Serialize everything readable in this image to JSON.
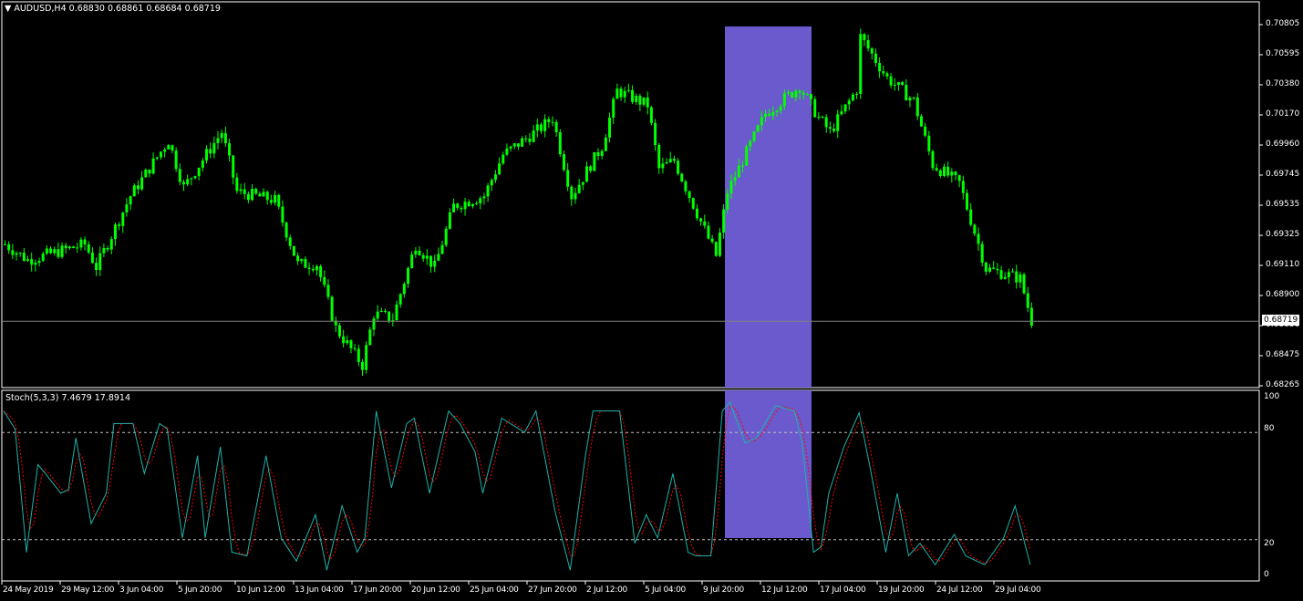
{
  "header": {
    "symbol": "AUDUSD,H4",
    "open": "0.68830",
    "high": "0.68861",
    "low": "0.68684",
    "close": "0.68719"
  },
  "indicator": {
    "name": "Stoch(5,3,3)",
    "main": "7.4679",
    "signal": "17.8914"
  },
  "current_price_label": "0.68719",
  "colors": {
    "bull": "#00ff00",
    "bear": "#00ff00",
    "highlight": "#6a5acd",
    "stoch_main": "#20b2aa",
    "stoch_signal": "#ff0000",
    "grid": "#c0c0c0"
  },
  "chart_data": [
    {
      "type": "candlestick",
      "title": "AUDUSD,H4",
      "ylim": [
        0.68265,
        0.70805
      ],
      "y_ticks": [
        "0.70805",
        "0.70595",
        "0.70380",
        "0.70170",
        "0.69960",
        "0.69745",
        "0.69535",
        "0.69325",
        "0.69110",
        "0.68900",
        "0.68686",
        "0.68475",
        "0.68265"
      ],
      "x_ticks": [
        "24 May 2019",
        "29 May 12:00",
        "3 Jun 04:00",
        "5 Jun 20:00",
        "10 Jun 12:00",
        "13 Jun 04:00",
        "17 Jun 20:00",
        "20 Jun 12:00",
        "25 Jun 04:00",
        "27 Jun 20:00",
        "2 Jul 12:00",
        "5 Jul 04:00",
        "9 Jul 20:00",
        "12 Jul 12:00",
        "17 Jul 04:00",
        "19 Jul 20:00",
        "24 Jul 12:00",
        "29 Jul 04:00"
      ],
      "bars": 270,
      "close_path_approx": [
        [
          0,
          0.6926
        ],
        [
          6,
          0.6915
        ],
        [
          21,
          0.6926
        ],
        [
          24,
          0.691
        ],
        [
          33,
          0.696
        ],
        [
          43,
          0.6999
        ],
        [
          47,
          0.6966
        ],
        [
          57,
          0.7005
        ],
        [
          61,
          0.6963
        ],
        [
          71,
          0.6957
        ],
        [
          77,
          0.6912
        ],
        [
          82,
          0.6912
        ],
        [
          87,
          0.6867
        ],
        [
          94,
          0.6841
        ],
        [
          97,
          0.6877
        ],
        [
          102,
          0.6874
        ],
        [
          108,
          0.6926
        ],
        [
          113,
          0.691
        ],
        [
          118,
          0.6953
        ],
        [
          126,
          0.696
        ],
        [
          131,
          0.6989
        ],
        [
          141,
          0.7008
        ],
        [
          144,
          0.7015
        ],
        [
          149,
          0.696
        ],
        [
          157,
          0.6995
        ],
        [
          161,
          0.7034
        ],
        [
          169,
          0.7024
        ],
        [
          172,
          0.6979
        ],
        [
          176,
          0.6985
        ],
        [
          180,
          0.696
        ],
        [
          187,
          0.6918
        ],
        [
          190,
          0.6963
        ],
        [
          200,
          0.7018
        ],
        [
          209,
          0.7037
        ],
        [
          214,
          0.7015
        ],
        [
          217,
          0.7005
        ],
        [
          224,
          0.7035
        ],
        [
          225,
          0.7072
        ],
        [
          232,
          0.7043
        ],
        [
          239,
          0.7027
        ],
        [
          244,
          0.6982
        ],
        [
          251,
          0.6969
        ],
        [
          258,
          0.6909
        ],
        [
          267,
          0.6902
        ],
        [
          270,
          0.6872
        ]
      ],
      "highlight_bars": [
        189,
        212
      ]
    },
    {
      "type": "line",
      "title": "Stoch(5,3,3)",
      "ylim": [
        0,
        100
      ],
      "y_ticks": [
        "100",
        "80",
        "20",
        "0"
      ],
      "levels": [
        80,
        20
      ],
      "main_path_approx": [
        [
          0,
          92
        ],
        [
          3,
          82
        ],
        [
          6,
          13
        ],
        [
          9,
          62
        ],
        [
          11,
          57
        ],
        [
          15,
          46
        ],
        [
          17,
          48
        ],
        [
          19,
          77
        ],
        [
          23,
          29
        ],
        [
          27,
          46
        ],
        [
          29,
          85
        ],
        [
          34,
          85
        ],
        [
          37,
          57
        ],
        [
          41,
          85
        ],
        [
          43,
          82
        ],
        [
          47,
          21
        ],
        [
          51,
          67
        ],
        [
          53,
          21
        ],
        [
          57,
          72
        ],
        [
          60,
          13
        ],
        [
          64,
          11
        ],
        [
          69,
          67
        ],
        [
          73,
          21
        ],
        [
          77,
          8
        ],
        [
          82,
          34
        ],
        [
          85,
          3
        ],
        [
          89,
          39
        ],
        [
          93,
          13
        ],
        [
          95,
          21
        ],
        [
          98,
          92
        ],
        [
          102,
          49
        ],
        [
          106,
          85
        ],
        [
          108,
          88
        ],
        [
          112,
          46
        ],
        [
          117,
          92
        ],
        [
          120,
          85
        ],
        [
          124,
          69
        ],
        [
          126,
          46
        ],
        [
          131,
          88
        ],
        [
          137,
          80
        ],
        [
          140,
          92
        ],
        [
          145,
          36
        ],
        [
          149,
          3
        ],
        [
          153,
          67
        ],
        [
          155,
          92
        ],
        [
          160,
          92
        ],
        [
          162,
          92
        ],
        [
          166,
          18
        ],
        [
          169,
          34
        ],
        [
          172,
          21
        ],
        [
          176,
          57
        ],
        [
          180,
          13
        ],
        [
          182,
          11
        ],
        [
          186,
          11
        ],
        [
          189,
          92
        ],
        [
          191,
          97
        ],
        [
          195,
          74
        ],
        [
          198,
          77
        ],
        [
          203,
          95
        ],
        [
          208,
          92
        ],
        [
          210,
          74
        ],
        [
          213,
          13
        ],
        [
          215,
          16
        ],
        [
          217,
          46
        ],
        [
          221,
          72
        ],
        [
          225,
          91
        ],
        [
          228,
          59
        ],
        [
          232,
          13
        ],
        [
          235,
          46
        ],
        [
          238,
          11
        ],
        [
          241,
          18
        ],
        [
          245,
          6
        ],
        [
          250,
          23
        ],
        [
          253,
          11
        ],
        [
          258,
          6
        ],
        [
          263,
          21
        ],
        [
          266,
          39
        ],
        [
          270,
          6
        ]
      ],
      "signal_period": 3
    }
  ]
}
